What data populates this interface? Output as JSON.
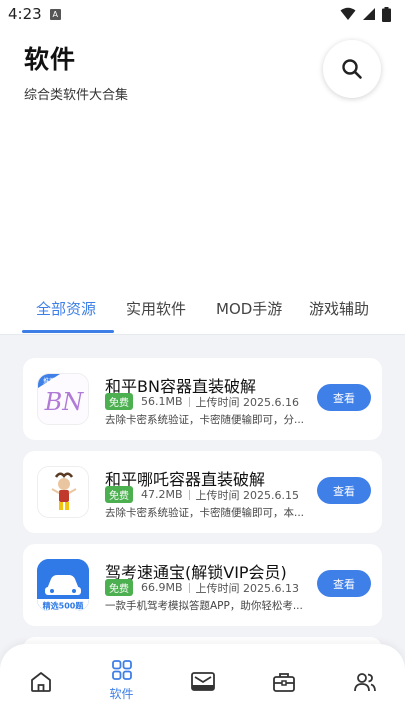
{
  "status_bar": {
    "time": "4:23",
    "notification_icon": "A",
    "icons": [
      "wifi-icon",
      "signal-icon",
      "battery-icon"
    ]
  },
  "header": {
    "title": "软件",
    "subtitle": "综合类软件大合集"
  },
  "tabs": [
    {
      "label": "全部资源",
      "active": true
    },
    {
      "label": "实用软件",
      "active": false
    },
    {
      "label": "MOD手游",
      "active": false
    },
    {
      "label": "游戏辅助",
      "active": false
    }
  ],
  "apps": [
    {
      "name": "和平BN容器直装破解",
      "badge": "免费",
      "size": "56.1MB",
      "upload": "上传时间 2025.6.16",
      "desc": "去除卡密系统验证，卡密随便输即可，分...",
      "button": "查看",
      "icon": "bn-logo-icon",
      "icon_text": "BN",
      "icon_tag": "推荐"
    },
    {
      "name": "和平哪吒容器直装破解",
      "badge": "免费",
      "size": "47.2MB",
      "upload": "上传时间 2025.6.15",
      "desc": "去除卡密系统验证，卡密随便输即可，本...",
      "button": "查看",
      "icon": "nezha-character-icon"
    },
    {
      "name": "驾考速通宝(解锁VIP会员)",
      "badge": "免费",
      "size": "66.9MB",
      "upload": "上传时间 2025.6.13",
      "desc": "一款手机驾考模拟答题APP，助你轻松考...",
      "button": "查看",
      "icon": "car-exam-icon",
      "icon_text": "精选500题"
    }
  ],
  "bottom_nav": [
    {
      "icon": "home-icon",
      "label": "",
      "active": false
    },
    {
      "icon": "apps-grid-icon",
      "label": "软件",
      "active": true
    },
    {
      "icon": "inbox-icon",
      "label": "",
      "active": false
    },
    {
      "icon": "toolbox-icon",
      "label": "",
      "active": false
    },
    {
      "icon": "users-icon",
      "label": "",
      "active": false
    }
  ],
  "colors": {
    "accent": "#3d7fe6",
    "badge_green": "#4caf50",
    "content_bg": "#f2f3f7"
  }
}
